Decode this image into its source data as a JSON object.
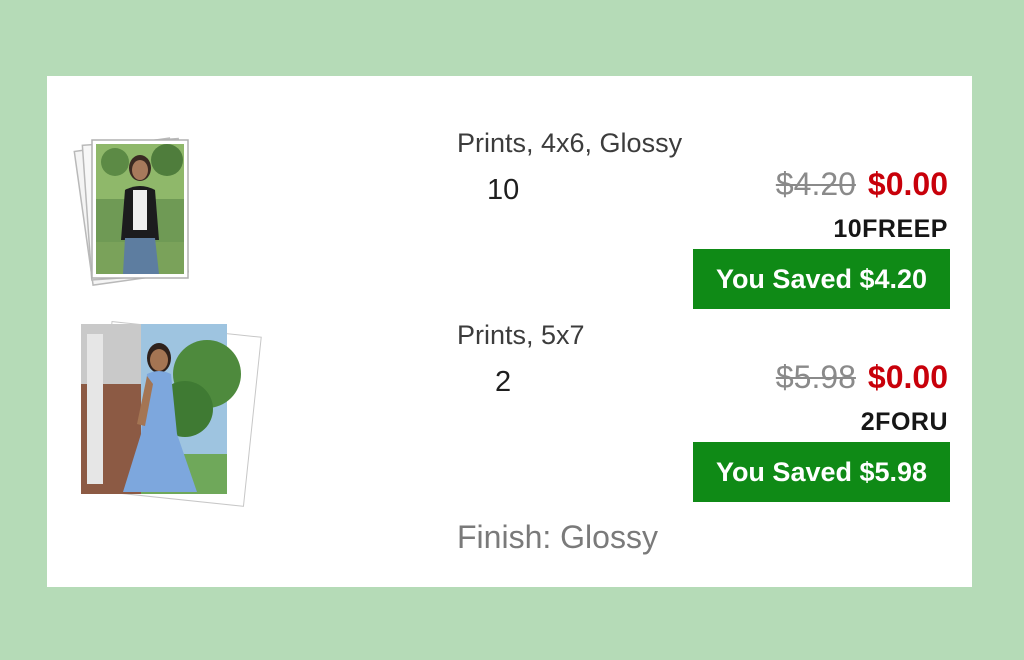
{
  "items": [
    {
      "name": "Prints, 4x6, Glossy",
      "quantity": "10",
      "original_price": "$4.20",
      "price": "$0.00",
      "promo_code": "10FREEP",
      "saved_label": "You Saved $4.20",
      "thumbnail_icon": "photo-prints-stack-icon"
    },
    {
      "name": "Prints, 5x7",
      "quantity": "2",
      "original_price": "$5.98",
      "price": "$0.00",
      "promo_code": "2FORU",
      "saved_label": "You Saved $5.98",
      "thumbnail_icon": "photo-prints-stack-icon"
    }
  ],
  "finish_label": "Finish: Glossy",
  "colors": {
    "page_background": "#b5dbb7",
    "card_background": "#ffffff",
    "sale_price": "#c8000a",
    "saved_badge": "#0f8a16",
    "original_price": "#8a8a8a"
  }
}
